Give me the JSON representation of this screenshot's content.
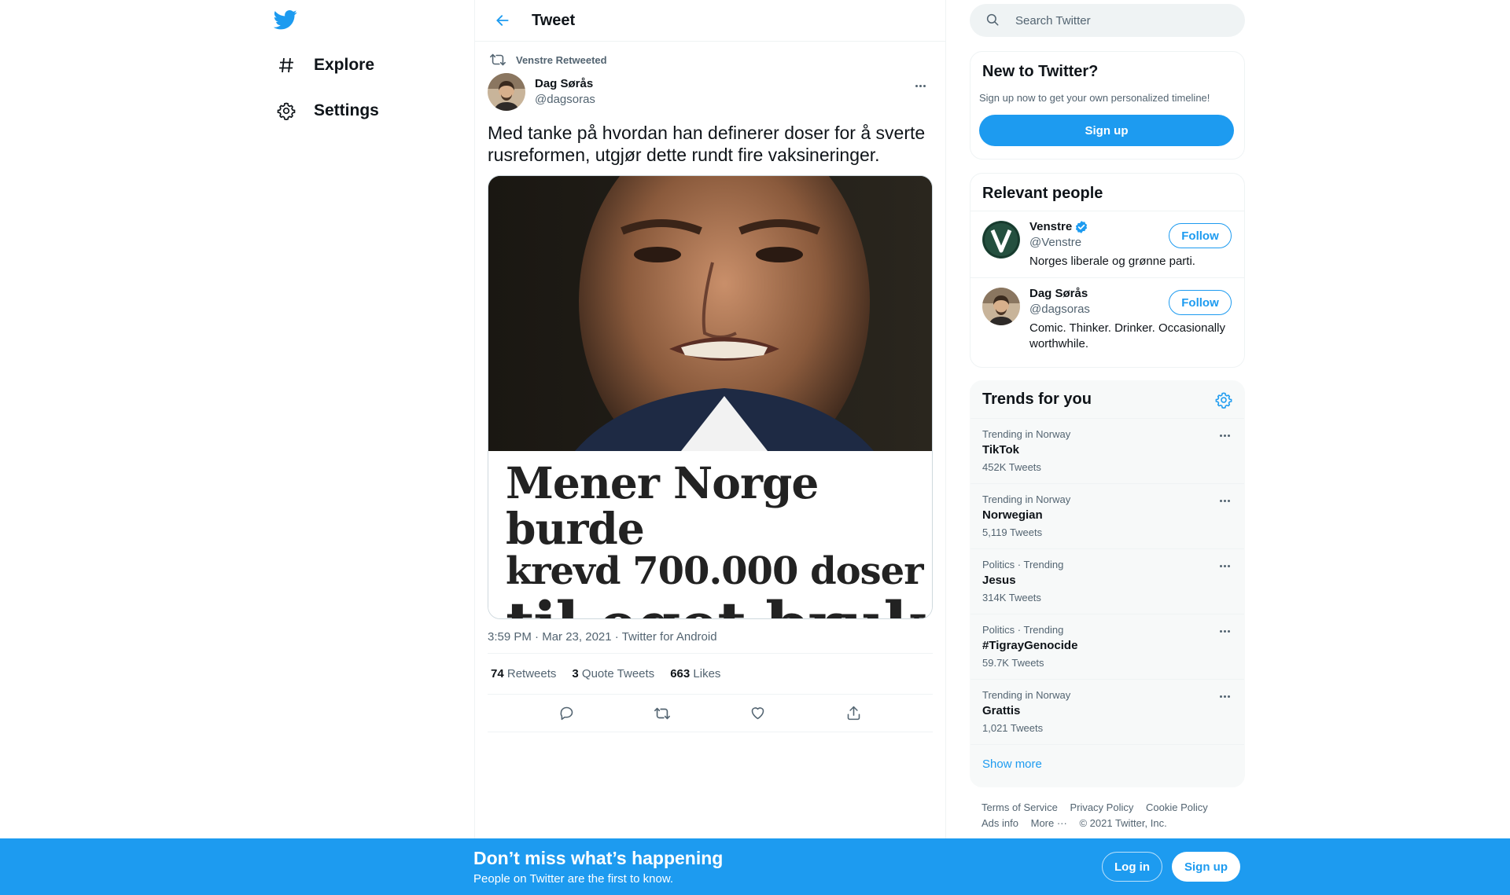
{
  "nav": {
    "items": [
      {
        "label": "Explore",
        "icon": "hashtag-icon"
      },
      {
        "label": "Settings",
        "icon": "gear-icon"
      }
    ]
  },
  "header": {
    "title": "Tweet"
  },
  "tweet": {
    "retweeted_by": "Venstre Retweeted",
    "author_name": "Dag Sørås",
    "author_handle": "@dagsoras",
    "text": "Med tanke på hvordan han definerer doser for å sverte rusreformen, utgjør dette rundt fire vaksineringer.",
    "image_headline": {
      "line1": "Mener Norge burde",
      "line2": "krevd 700.000 doser",
      "line3": "til eget bruk"
    },
    "time": "3:59 PM",
    "date": "Mar 23, 2021",
    "source": "Twitter for Android",
    "stats": {
      "retweets": "74",
      "retweets_label": "Retweets",
      "quotes": "3",
      "quotes_label": "Quote Tweets",
      "likes": "663",
      "likes_label": "Likes"
    }
  },
  "search": {
    "placeholder": "Search Twitter"
  },
  "new_to_twitter": {
    "title": "New to Twitter?",
    "subtitle": "Sign up now to get your own personalized timeline!",
    "button": "Sign up"
  },
  "relevant": {
    "title": "Relevant people",
    "people": [
      {
        "name": "Venstre",
        "handle": "@Venstre",
        "bio": "Norges liberale og grønne parti.",
        "follow": "Follow",
        "verified": true
      },
      {
        "name": "Dag Sørås",
        "handle": "@dagsoras",
        "bio": "Comic. Thinker. Drinker. Occasionally worthwhile.",
        "follow": "Follow",
        "verified": false
      }
    ]
  },
  "trends": {
    "title": "Trends for you",
    "items": [
      {
        "context": "Trending in Norway",
        "name": "TikTok",
        "count": "452K Tweets"
      },
      {
        "context": "Trending in Norway",
        "name": "Norwegian",
        "count": "5,119 Tweets"
      },
      {
        "context": "Politics · Trending",
        "name": "Jesus",
        "count": "314K Tweets"
      },
      {
        "context": "Politics · Trending",
        "name": "#TigrayGenocide",
        "count": "59.7K Tweets"
      },
      {
        "context": "Trending in Norway",
        "name": "Grattis",
        "count": "1,021 Tweets"
      }
    ],
    "show_more": "Show more"
  },
  "footer": {
    "links": [
      "Terms of Service",
      "Privacy Policy",
      "Cookie Policy",
      "Ads info",
      "More ···"
    ],
    "copyright": "© 2021 Twitter, Inc."
  },
  "bottom_bar": {
    "title": "Don’t miss what’s happening",
    "subtitle": "People on Twitter are the first to know.",
    "login": "Log in",
    "signup": "Sign up"
  },
  "colors": {
    "accent": "#1d9bf0",
    "text": "#0f1419",
    "secondary": "#536471",
    "border": "#eff3f4"
  }
}
